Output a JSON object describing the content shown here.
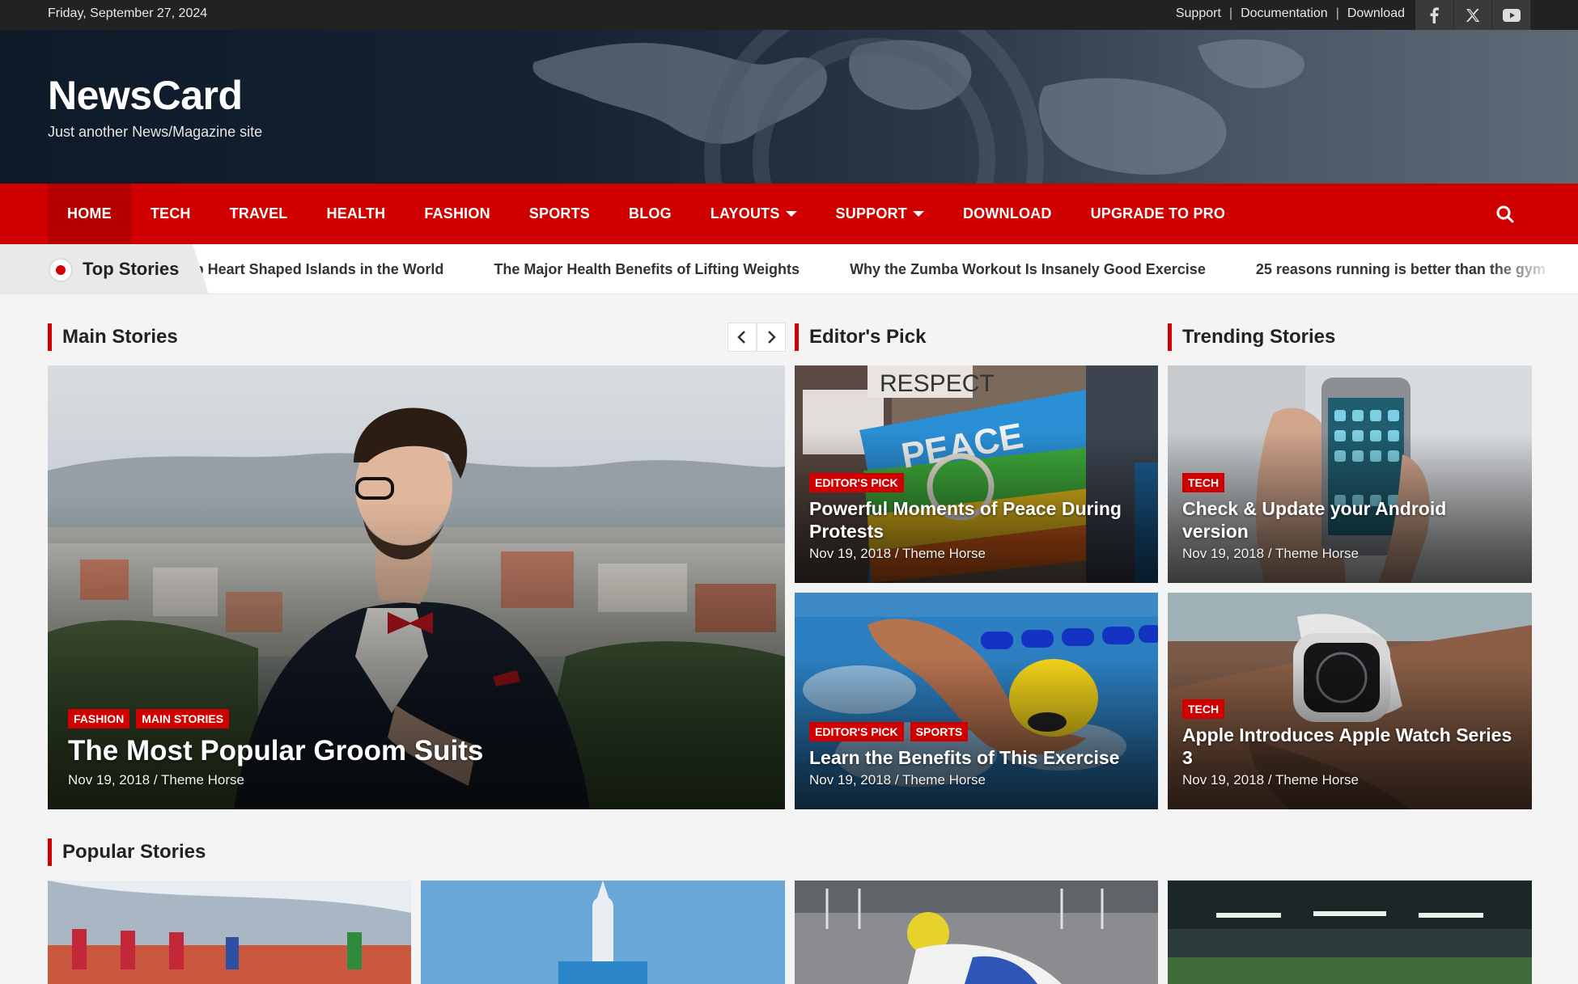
{
  "topbar": {
    "date": "Friday, September 27, 2024",
    "links": [
      "Support",
      "Documentation",
      "Download"
    ],
    "social_icons": [
      "facebook-icon",
      "x-icon",
      "youtube-icon"
    ]
  },
  "header": {
    "site_title": "NewsCard",
    "tagline": "Just another News/Magazine site"
  },
  "nav": {
    "items": [
      {
        "label": "HOME",
        "active": true,
        "dropdown": false
      },
      {
        "label": "TECH",
        "active": false,
        "dropdown": false
      },
      {
        "label": "TRAVEL",
        "active": false,
        "dropdown": false
      },
      {
        "label": "HEALTH",
        "active": false,
        "dropdown": false
      },
      {
        "label": "FASHION",
        "active": false,
        "dropdown": false
      },
      {
        "label": "SPORTS",
        "active": false,
        "dropdown": false
      },
      {
        "label": "BLOG",
        "active": false,
        "dropdown": false
      },
      {
        "label": "LAYOUTS",
        "active": false,
        "dropdown": true
      },
      {
        "label": "SUPPORT",
        "active": false,
        "dropdown": true
      },
      {
        "label": "DOWNLOAD",
        "active": false,
        "dropdown": false
      },
      {
        "label": "UPGRADE TO PRO",
        "active": false,
        "dropdown": false
      }
    ],
    "search_icon": "search-icon"
  },
  "ticker": {
    "label": "Top Stories",
    "items": [
      "Top Heart Shaped Islands in the World",
      "The Major Health Benefits of Lifting Weights",
      "Why the Zumba Workout Is Insanely Good Exercise",
      "25 reasons running is better than the gym"
    ]
  },
  "sections": {
    "main": "Main Stories",
    "editors": "Editor's Pick",
    "trending": "Trending Stories",
    "popular": "Popular Stories"
  },
  "main_story": {
    "badges": [
      "FASHION",
      "MAIN STORIES"
    ],
    "title": "The Most Popular Groom Suits",
    "byline": "Nov 19, 2018 / Theme Horse"
  },
  "editors_pick": [
    {
      "badges": [
        "EDITOR'S PICK"
      ],
      "title": "Powerful Moments of Peace During Protests",
      "byline": "Nov 19, 2018 / Theme Horse"
    },
    {
      "badges": [
        "EDITOR'S PICK",
        "SPORTS"
      ],
      "title": "Learn the Benefits of This Exercise",
      "byline": "Nov 19, 2018 / Theme Horse"
    }
  ],
  "trending": [
    {
      "badges": [
        "TECH"
      ],
      "title": "Check & Update your Android version",
      "byline": "Nov 19, 2018 / Theme Horse"
    },
    {
      "badges": [
        "TECH"
      ],
      "title": "Apple Introduces Apple Watch Series 3",
      "byline": "Nov 19, 2018 / Theme Horse"
    }
  ],
  "image_text": {
    "peace_flag": "PEACE",
    "sign": "RESPECT"
  },
  "colors": {
    "accent": "#d10000",
    "topbar": "#222222"
  }
}
